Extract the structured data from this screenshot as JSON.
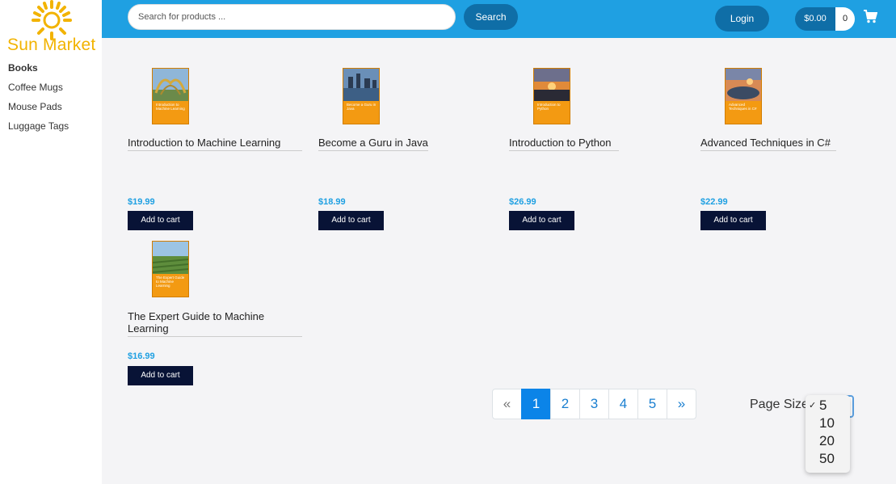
{
  "logo": {
    "text": "Sun Market",
    "color": "#f2b300"
  },
  "sidebar": {
    "categories": [
      {
        "label": "Books",
        "active": true
      },
      {
        "label": "Coffee Mugs"
      },
      {
        "label": "Mouse Pads"
      },
      {
        "label": "Luggage Tags"
      }
    ]
  },
  "header": {
    "search_placeholder": "Search for products ...",
    "search_label": "Search",
    "login_label": "Login",
    "cart_total": "$0.00",
    "cart_count": "0",
    "cart_icon": "shopping-cart-icon"
  },
  "products": [
    {
      "title": "Introduction to Machine Learning",
      "price": "$19.99",
      "add_label": "Add to cart",
      "cover_text": "Introduction to Machine Learning"
    },
    {
      "title": "Become a Guru in Java",
      "price": "$18.99",
      "add_label": "Add to cart",
      "cover_text": "Become a Guru in Java"
    },
    {
      "title": "Introduction to Python",
      "price": "$26.99",
      "add_label": "Add to cart",
      "cover_text": "Introduction to Python"
    },
    {
      "title": "Advanced Techniques in C#",
      "price": "$22.99",
      "add_label": "Add to cart",
      "cover_text": "Advanced Techniques in C#"
    },
    {
      "title": "The Expert Guide to Machine Learning",
      "price": "$16.99",
      "add_label": "Add to cart",
      "cover_text": "The Expert Guide to Machine Learning"
    }
  ],
  "pagination": {
    "prev": "«",
    "pages": [
      "1",
      "2",
      "3",
      "4",
      "5"
    ],
    "current": "1",
    "next": "»"
  },
  "page_size": {
    "label": "Page Size",
    "options": [
      "5",
      "10",
      "20",
      "50"
    ],
    "selected": "5",
    "check": "✓"
  },
  "colors": {
    "header": "#1fa0e2",
    "button": "#0f6ea7",
    "cart_button": "#081336",
    "price": "#1fa0e2",
    "active_page": "#0b84e8"
  }
}
